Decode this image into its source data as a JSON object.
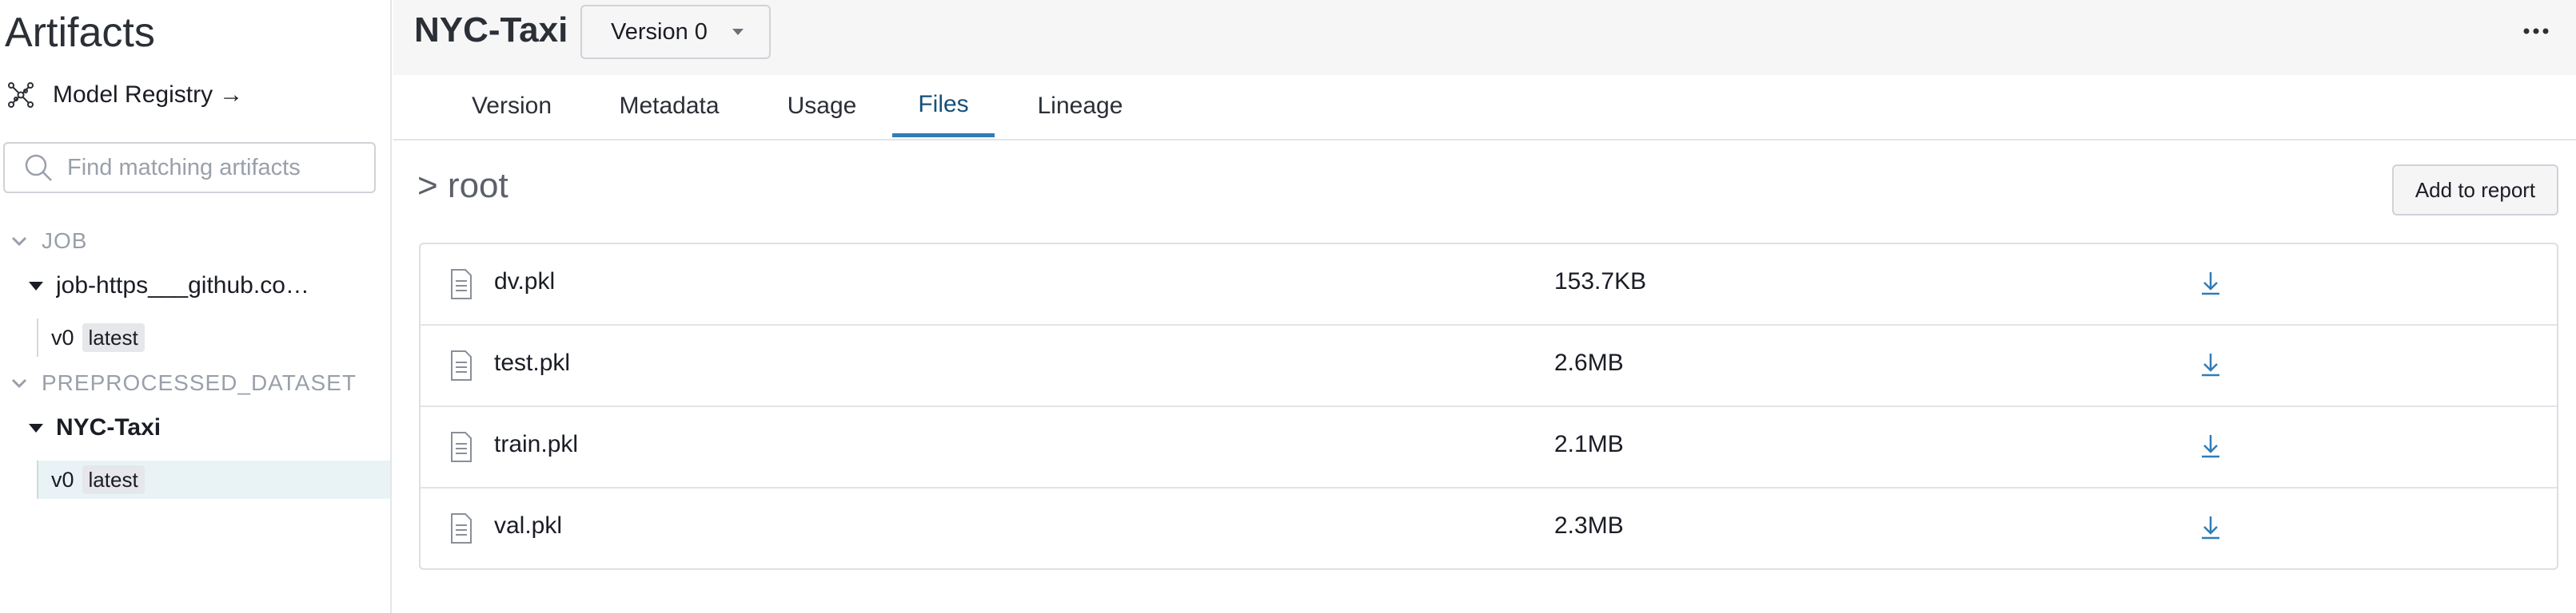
{
  "sidebar": {
    "title": "Artifacts",
    "registry_link": {
      "label": "Model Registry",
      "arrow": "→"
    },
    "search": {
      "placeholder": "Find matching artifacts",
      "value": ""
    },
    "groups": [
      {
        "name": "JOB",
        "artifacts": [
          {
            "name": "job-https___github.co…",
            "versions": [
              {
                "version": "v0",
                "alias": "latest"
              }
            ]
          }
        ]
      },
      {
        "name": "PREPROCESSED_DATASET",
        "artifacts": [
          {
            "name": "NYC-Taxi",
            "versions": [
              {
                "version": "v0",
                "alias": "latest"
              }
            ]
          }
        ]
      }
    ]
  },
  "header": {
    "title": "NYC-Taxi",
    "version_select": "Version 0"
  },
  "tabs": [
    "Version",
    "Metadata",
    "Usage",
    "Files",
    "Lineage"
  ],
  "active_tab": "Files",
  "files": {
    "breadcrumb": "> root",
    "add_to_report": "Add to report",
    "rows": [
      {
        "name": "dv.pkl",
        "size": "153.7KB"
      },
      {
        "name": "test.pkl",
        "size": "2.6MB"
      },
      {
        "name": "train.pkl",
        "size": "2.1MB"
      },
      {
        "name": "val.pkl",
        "size": "2.3MB"
      }
    ]
  },
  "colors": {
    "accent": "#2e7db6",
    "selected_row": "#e9f3f6",
    "header_bg": "#f6f6f7"
  }
}
